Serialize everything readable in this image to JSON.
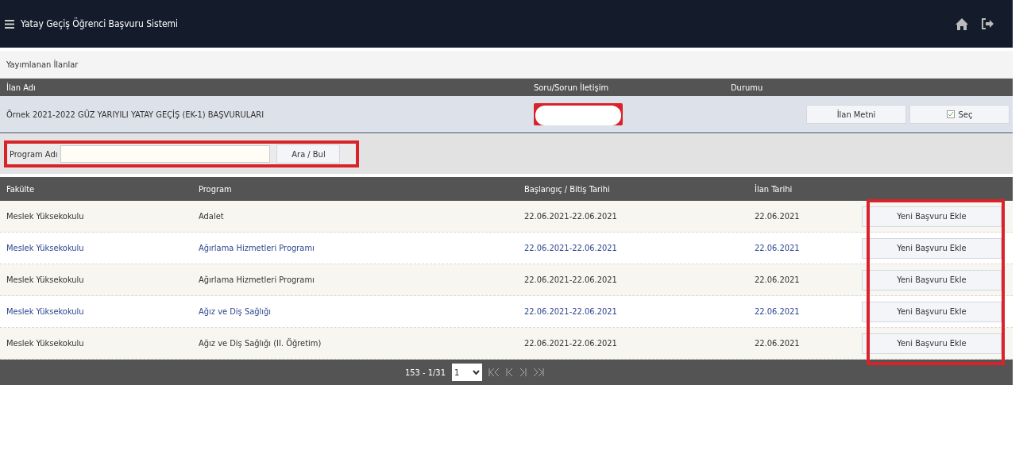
{
  "header": {
    "title": "Yatay Geçiş Öğrenci Başvuru Sistemi"
  },
  "section": {
    "title": "Yayımlanan İlanlar"
  },
  "announcements": {
    "columns": [
      "İlan Adı",
      "Soru/Sorun İletişim",
      "Durumu"
    ],
    "rows": [
      {
        "name": "Örnek 2021-2022 GÜZ YARIYILI YATAY GEÇİŞ (EK-1) BAŞVURULARI",
        "text_button": "İlan Metni",
        "select_button": "Seç",
        "checked": true
      }
    ]
  },
  "search": {
    "label": "Program Adı",
    "button": "Ara / Bul"
  },
  "table": {
    "columns": [
      "Fakülte",
      "Program",
      "Başlangıç / Bitiş Tarihi",
      "İlan Tarihi"
    ],
    "rows": [
      {
        "faculty": "Meslek Yüksekokulu",
        "program": "Adalet",
        "dates": "22.06.2021-22.06.2021",
        "posted": "22.06.2021",
        "button": "Yeni Başvuru Ekle"
      },
      {
        "faculty": "Meslek Yüksekokulu",
        "program": "Ağırlama Hizmetleri Programı",
        "dates": "22.06.2021-22.06.2021",
        "posted": "22.06.2021",
        "button": "Yeni Başvuru Ekle"
      },
      {
        "faculty": "Meslek Yüksekokulu",
        "program": "Ağırlama Hizmetleri Programı",
        "dates": "22.06.2021-22.06.2021",
        "posted": "22.06.2021",
        "button": "Yeni Başvuru Ekle"
      },
      {
        "faculty": "Meslek Yüksekokulu",
        "program": "Ağız ve Diş Sağlığı",
        "dates": "22.06.2021-22.06.2021",
        "posted": "22.06.2021",
        "button": "Yeni Başvuru Ekle"
      },
      {
        "faculty": "Meslek Yüksekokulu",
        "program": "Ağız ve Diş Sağlığı (II. Öğretim)",
        "dates": "22.06.2021-22.06.2021",
        "posted": "22.06.2021",
        "button": "Yeni Başvuru Ekle"
      }
    ]
  },
  "pager": {
    "summary": "153 - 1/31",
    "page": "1"
  }
}
